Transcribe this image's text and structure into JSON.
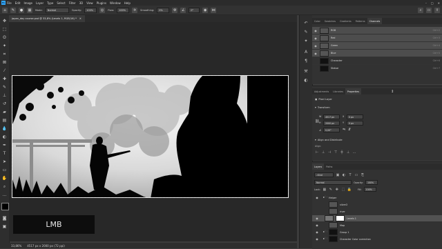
{
  "menubar": {
    "logo": "Ps",
    "items": [
      "File",
      "Edit",
      "Image",
      "Layer",
      "Type",
      "Select",
      "Filter",
      "3D",
      "View",
      "Plugins",
      "Window",
      "Help"
    ]
  },
  "options": {
    "mode_label": "Mode:",
    "mode_value": "Normal",
    "opacity_label": "Opacity:",
    "opacity_value": "100%",
    "flow_label": "Flow:",
    "flow_value": "100%",
    "smoothing_label": "Smoothing:",
    "smoothing_value": "0%",
    "angle_value": "0°"
  },
  "document": {
    "tab_title": "japan_day course.psd @ 33,8% (Levels 1, RGB/16) *",
    "zoom": "33,86%",
    "doc_size": "4517 px x 2000 px (72 ppi)"
  },
  "overlay": {
    "lmb_label": "LMB"
  },
  "channels_panel": {
    "tabs": [
      "Color",
      "Swatches",
      "Gradients",
      "Patterns",
      "Channels"
    ],
    "active_tab": "Channels",
    "rows": [
      {
        "name": "RGB",
        "shortcut": "Ctrl+2",
        "selected": true
      },
      {
        "name": "Red",
        "shortcut": "Ctrl+3",
        "selected": true
      },
      {
        "name": "Green",
        "shortcut": "Ctrl+4",
        "selected": true
      },
      {
        "name": "Blue",
        "shortcut": "Ctrl+5",
        "selected": true
      },
      {
        "name": "Character",
        "shortcut": "Ctrl+6",
        "selected": false
      },
      {
        "name": "Statue",
        "shortcut": "Ctrl+7",
        "selected": false
      }
    ]
  },
  "properties_panel": {
    "tabs": [
      "Adjustments",
      "Libraries",
      "Properties"
    ],
    "active_tab": "Properties",
    "layer_type": "Pixel Layer",
    "transform_title": "Transform",
    "w_label": "W",
    "w_value": "4517 px",
    "h_label": "H",
    "h_value": "2000 px",
    "x_label": "X",
    "x_value": "0 px",
    "y_label": "Y",
    "y_value": "0 px",
    "angle_value": "0,00°",
    "align_title": "Align and Distribute",
    "align_sub": "Align:"
  },
  "layers_panel": {
    "tabs": [
      "Layers",
      "Paths"
    ],
    "active_tab": "Layers",
    "kind_value": "Kind",
    "blend_value": "Normal",
    "opacity_label": "Opacity:",
    "opacity_value": "100%",
    "lock_label": "Lock:",
    "fill_label": "Fill:",
    "fill_value": "100%",
    "rows": [
      {
        "name": "Helper",
        "kind": "folder",
        "selected": false
      },
      {
        "name": "silver2",
        "kind": "layer",
        "selected": false
      },
      {
        "name": "river",
        "kind": "layer",
        "selected": false
      },
      {
        "name": "Levels 1",
        "kind": "adjustment",
        "selected": true
      },
      {
        "name": "Map",
        "kind": "layer",
        "selected": false
      },
      {
        "name": "Group 1",
        "kind": "folder",
        "selected": false
      },
      {
        "name": "Character Color correction",
        "kind": "folder",
        "selected": false
      }
    ]
  },
  "colors": {
    "accent": "#31a8ff",
    "panel_bg": "#323232",
    "selected_row": "#525252"
  }
}
